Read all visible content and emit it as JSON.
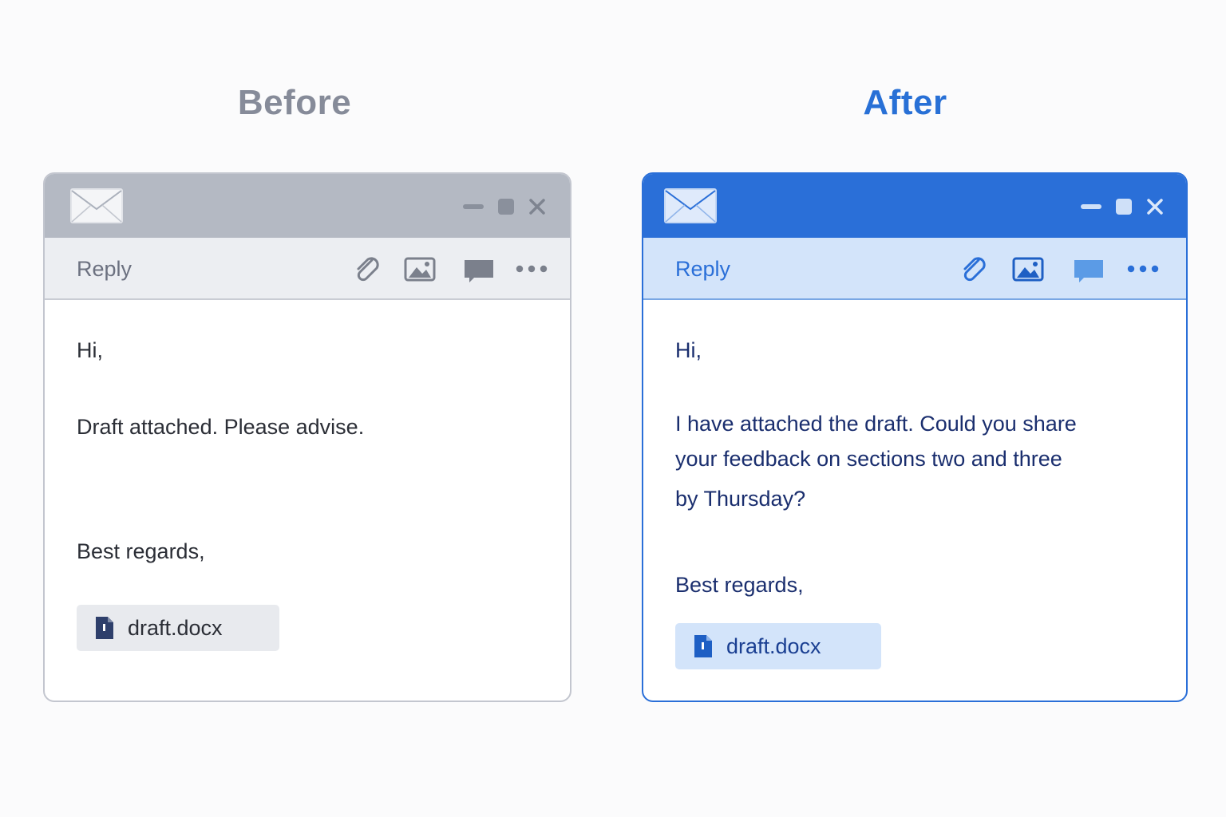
{
  "before": {
    "title": "Before",
    "toolbar": {
      "reply_label": "Reply"
    },
    "body": {
      "greeting": "Hi,",
      "message_lines": [
        "Draft attached. Please advise."
      ],
      "signoff": "Best regards,"
    },
    "attachment": {
      "name": "draft.docx",
      "icon": "document-icon"
    },
    "colors": {
      "accent": "#868b99",
      "titlebar": "#b4b9c3"
    }
  },
  "after": {
    "title": "After",
    "toolbar": {
      "reply_label": "Reply"
    },
    "body": {
      "greeting": "Hi,",
      "message_lines": [
        "I have attached the draft. Could you share",
        "your feedback on sections two and three",
        "by Thursday?"
      ],
      "signoff": "Best regards,"
    },
    "attachment": {
      "name": "draft.docx",
      "icon": "document-icon"
    },
    "colors": {
      "accent": "#2870d6",
      "titlebar": "#2a6fd8"
    }
  },
  "icons": [
    "envelope-icon",
    "minimize-icon",
    "maximize-icon",
    "close-icon",
    "paperclip-icon",
    "image-icon",
    "comment-icon",
    "more-icon"
  ]
}
